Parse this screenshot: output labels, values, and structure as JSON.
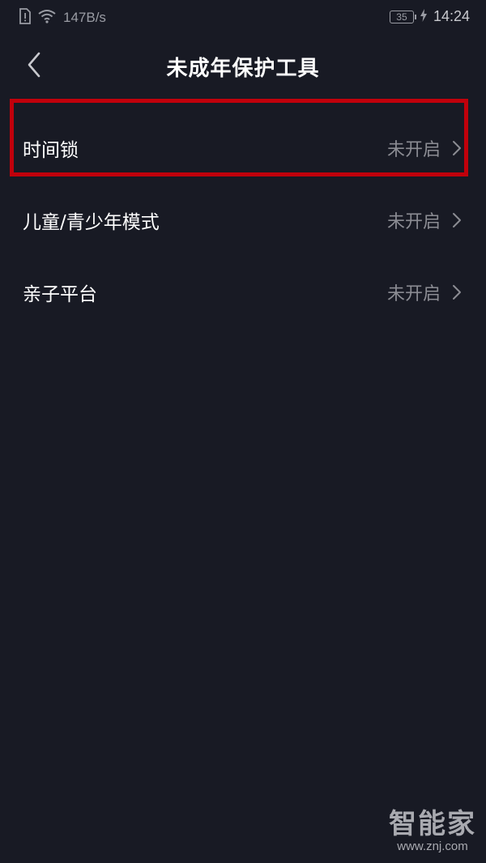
{
  "status_bar": {
    "network_speed": "147B/s",
    "battery_level": "35",
    "time": "14:24",
    "icons": [
      "sim-alert-icon",
      "wifi-icon",
      "battery-icon",
      "charging-icon"
    ]
  },
  "header": {
    "title": "未成年保护工具",
    "back_icon": "chevron-left-icon"
  },
  "menu": {
    "items": [
      {
        "label": "时间锁",
        "status": "未开启"
      },
      {
        "label": "儿童/青少年模式",
        "status": "未开启"
      },
      {
        "label": "亲子平台",
        "status": "未开启"
      }
    ]
  },
  "watermark": {
    "main": "智能家",
    "sub": "www.znj.com"
  },
  "colors": {
    "background": "#181a24",
    "highlight": "#c0000b",
    "secondary_text": "#8b8c93"
  }
}
